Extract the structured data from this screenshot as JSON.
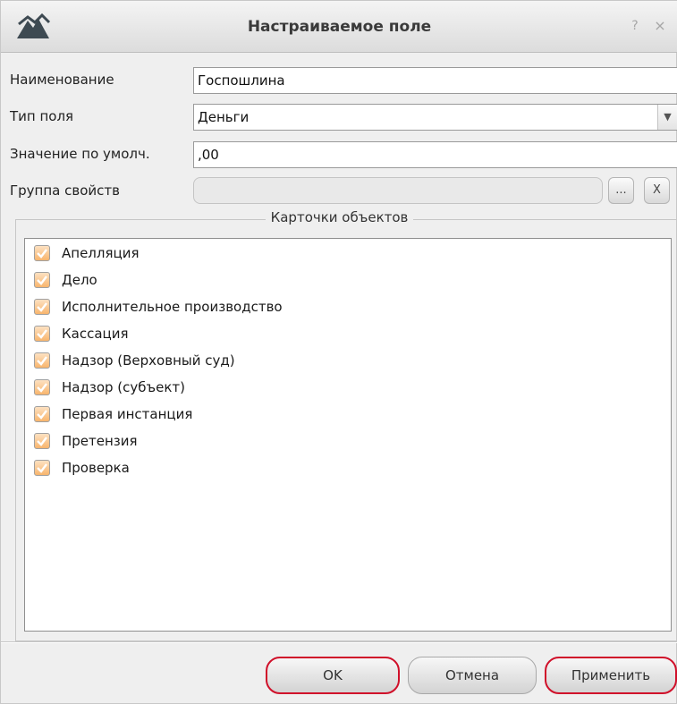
{
  "window": {
    "title": "Настраиваемое поле",
    "help_label": "?",
    "close_label": "×"
  },
  "form": {
    "name_label": "Наименование",
    "name_value": "Госпошлина",
    "type_label": "Тип поля",
    "type_value": "Деньги",
    "default_label": "Значение по умолч.",
    "default_value": ",00",
    "group_label": "Группа свойств",
    "group_value": "",
    "browse_label": "...",
    "clear_label": "X"
  },
  "cards": {
    "legend": "Карточки объектов",
    "items": [
      {
        "label": "Апелляция",
        "checked": true
      },
      {
        "label": "Дело",
        "checked": true
      },
      {
        "label": "Исполнительное производство",
        "checked": true
      },
      {
        "label": "Кассация",
        "checked": true
      },
      {
        "label": "Надзор (Верховный суд)",
        "checked": true
      },
      {
        "label": "Надзор (субъект)",
        "checked": true
      },
      {
        "label": "Первая инстанция",
        "checked": true
      },
      {
        "label": "Претензия",
        "checked": true
      },
      {
        "label": "Проверка",
        "checked": true
      }
    ]
  },
  "buttons": {
    "ok": "OK",
    "cancel": "Отмена",
    "apply": "Применить"
  },
  "colors": {
    "highlight": "#d0102a",
    "checkbox": "#f8b56d",
    "checkmark": "#ffffff"
  }
}
